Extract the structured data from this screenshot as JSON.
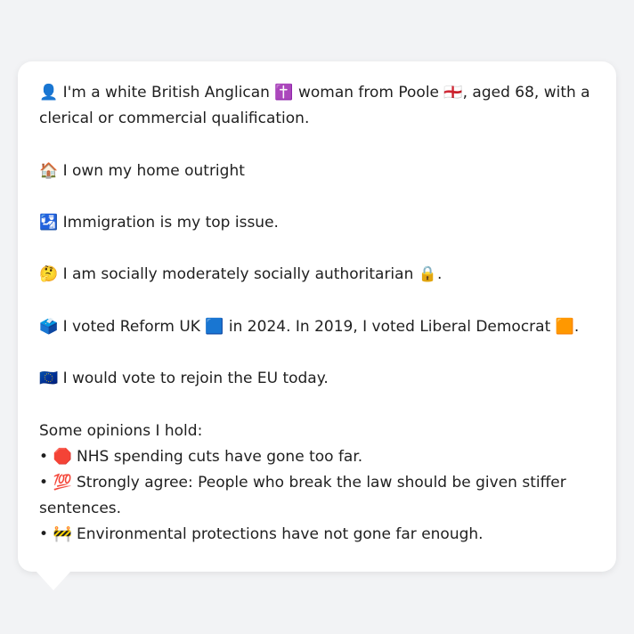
{
  "message": {
    "identity": {
      "icon": "👤",
      "text_before_religion": "I'm a white British Anglican",
      "religion_icon": "✝️",
      "text_before_place": "woman from Poole",
      "place_icon": "🏴󠁧󠁢󠁥󠁮󠁧󠁿",
      "text_after_place": ", aged 68, with a clerical or commercial qualification."
    },
    "housing": {
      "icon": "🏠",
      "text": "I own my home outright"
    },
    "issue": {
      "icon": "🛂",
      "text": "Immigration is my top issue."
    },
    "social": {
      "icon": "🤔",
      "text": "I am socially moderately socially authoritarian",
      "end_icon": "🔒",
      "end_punct": "."
    },
    "vote": {
      "icon": "🗳️",
      "text_a": "I voted Reform UK",
      "party_a_icon": "🟦",
      "text_b": "in 2024. In 2019, I voted Liberal Democrat",
      "party_b_icon": "🟧",
      "end_punct": "."
    },
    "eu": {
      "icon": "🇪🇺",
      "text": "I would vote to rejoin the EU today."
    },
    "opinions_heading": "Some opinions I hold:",
    "opinions": [
      {
        "bullet": "•",
        "icon": "🛑",
        "text": "NHS spending cuts have gone too far."
      },
      {
        "bullet": "•",
        "icon": "💯",
        "text": "Strongly agree: People who break the law should be given stiffer sentences."
      },
      {
        "bullet": "•",
        "icon": "🚧",
        "text": "Environmental protections have not gone far enough."
      }
    ]
  }
}
